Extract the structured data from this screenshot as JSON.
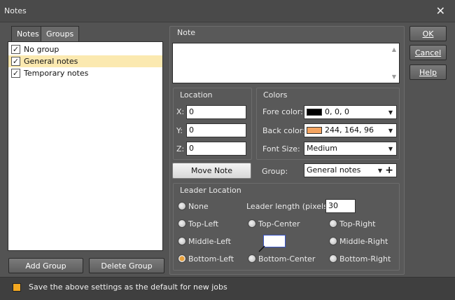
{
  "window": {
    "title": "Notes",
    "close_glyph": "✕"
  },
  "tabs": [
    {
      "label": "Notes"
    },
    {
      "label": "Groups"
    }
  ],
  "groups_list": [
    {
      "label": "No group",
      "checked": true
    },
    {
      "label": "General notes",
      "checked": true,
      "selected": true
    },
    {
      "label": "Temporary notes",
      "checked": true
    }
  ],
  "buttons": {
    "add_group": "Add Group",
    "delete_group": "Delete Group",
    "ok": "OK",
    "cancel": "Cancel",
    "help": "Help",
    "move_note": "Move Note"
  },
  "note_section": {
    "title": "Note",
    "text": ""
  },
  "location": {
    "title": "Location",
    "x_label": "X:",
    "x_value": "0",
    "y_label": "Y:",
    "y_value": "0",
    "z_label": "Z:",
    "z_value": "0"
  },
  "colors": {
    "title": "Colors",
    "fore_label": "Fore color:",
    "fore_value": "0, 0, 0",
    "fore_hex": "#000000",
    "back_label": "Back color:",
    "back_value": "244, 164, 96",
    "back_hex": "#f4a460",
    "font_size_label": "Font Size:",
    "font_size_value": "Medium"
  },
  "group_select": {
    "label": "Group:",
    "value": "General notes",
    "add_glyph": "+"
  },
  "leader": {
    "title": "Leader Location",
    "length_label": "Leader length (pixels):",
    "length_value": "30",
    "options": {
      "none": "None",
      "top_left": "Top-Left",
      "top_center": "Top-Center",
      "top_right": "Top-Right",
      "middle_left": "Middle-Left",
      "middle_right": "Middle-Right",
      "bottom_left": "Bottom-Left",
      "bottom_center": "Bottom-Center",
      "bottom_right": "Bottom-Right"
    },
    "selected": "bottom_left"
  },
  "footer": {
    "default_label": "Save the above settings as the default for new jobs",
    "checked": true
  },
  "accent_color": "#f3a821",
  "icons": {
    "checkmark": "✓",
    "dropdown": "▼",
    "scroll_up": "▲",
    "scroll_down": "▼"
  }
}
